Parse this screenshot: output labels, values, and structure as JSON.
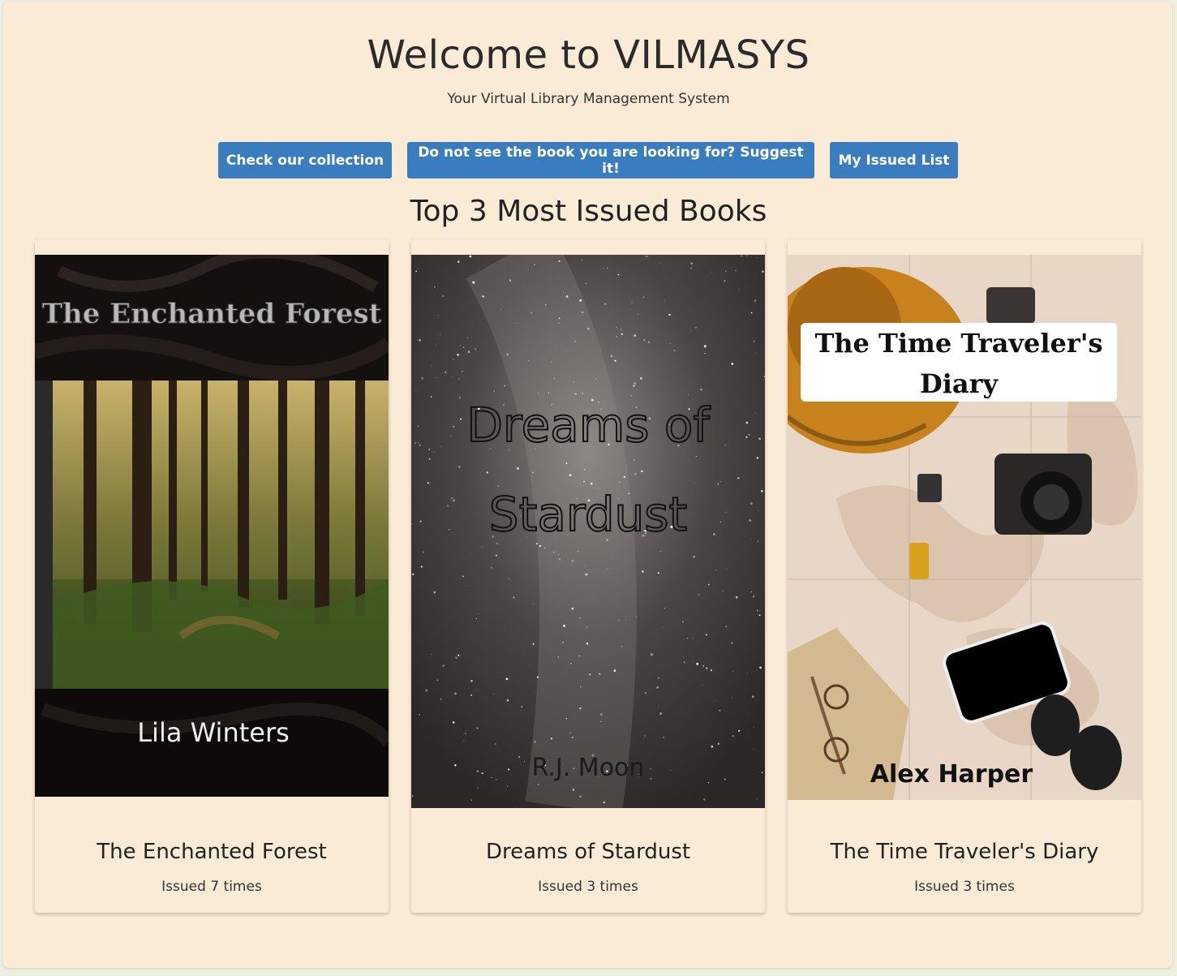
{
  "header": {
    "title": "Welcome to VILMASYS",
    "subtitle": "Your Virtual Library Management System"
  },
  "actions": {
    "collection_label": "Check our collection",
    "suggest_label": "Do not see the book you are looking for? Suggest it!",
    "issued_label": "My Issued List",
    "button_color": "#3a7dbf"
  },
  "section": {
    "title": "Top 3 Most Issued Books"
  },
  "books": [
    {
      "title": "The Enchanted Forest",
      "issued": "Issued 7 times",
      "cover_title": "The Enchanted Forest",
      "cover_author": "Lila Winters"
    },
    {
      "title": "Dreams of Stardust",
      "issued": "Issued 3 times",
      "cover_title_line1": "Dreams of",
      "cover_title_line2": "Stardust",
      "cover_author": "R.J. Moon"
    },
    {
      "title": "The Time Traveler's Diary",
      "issued": "Issued 3 times",
      "cover_title_line1": "The Time Traveler's",
      "cover_title_line2": "Diary",
      "cover_author": "Alex Harper"
    }
  ],
  "colors": {
    "page_bg": "#faebd7",
    "accent": "#3a7dbf"
  }
}
